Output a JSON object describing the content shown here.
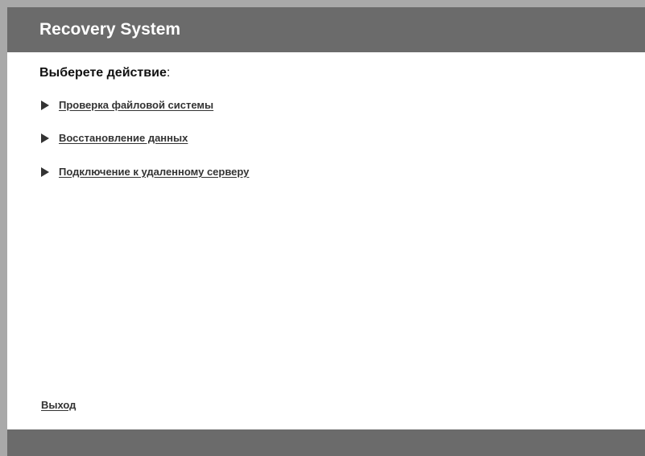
{
  "window": {
    "title": "Recovery System"
  },
  "main": {
    "heading": "Выберете действие",
    "heading_colon": ":",
    "actions": [
      {
        "label": "Проверка файловой системы",
        "icon": "triangle-right-icon"
      },
      {
        "label": "Восстановление данных",
        "icon": "triangle-right-icon"
      },
      {
        "label": "Подключение к удаленному серверу",
        "icon": "triangle-right-icon"
      }
    ],
    "exit_label": "Выход"
  },
  "colors": {
    "titlebar": "#6b6b6b",
    "border": "#a9a9a9",
    "link": "#333333",
    "background": "#ffffff"
  }
}
